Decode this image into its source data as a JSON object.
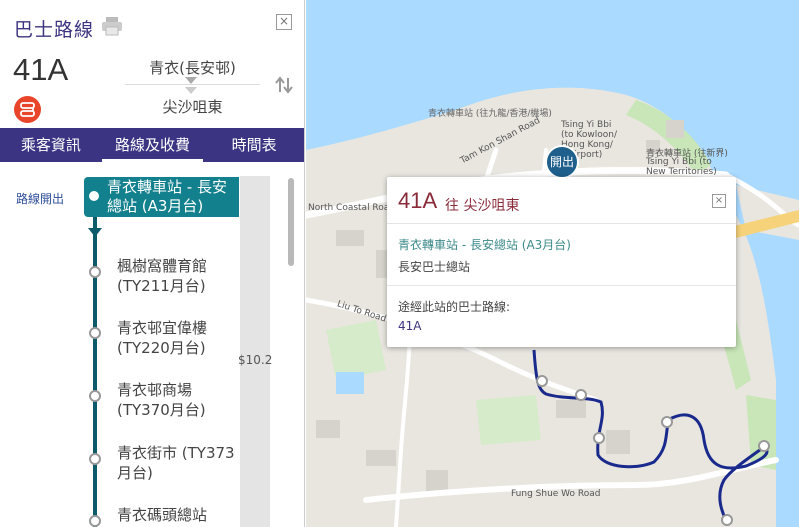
{
  "panel": {
    "title": "巴士路線",
    "route_number": "41A",
    "direction_from": "青衣(長安邨)",
    "direction_to": "尖沙咀東",
    "close_symbol": "×",
    "icons": {
      "print": "print-icon",
      "swap": "swap-direction-icon",
      "badge": "route-type-icon",
      "close": "close-icon"
    }
  },
  "tabs": [
    {
      "label": "乘客資訊"
    },
    {
      "label": "路線及收費",
      "active": true
    },
    {
      "label": "時間表"
    }
  ],
  "route_list": {
    "depart_label": "路線開出",
    "fare": "$10.2",
    "first_stop": "青衣轉車站 - 長安總站 (A3月台)",
    "stops": [
      {
        "name": "楓樹窩體育館 (TY211月台)"
      },
      {
        "name": "青衣邨宜偉樓 (TY220月台)"
      },
      {
        "name": "青衣邨商場 (TY370月台)"
      },
      {
        "name": "青衣街市 (TY373月台)"
      },
      {
        "name": "青衣碼頭總站"
      }
    ]
  },
  "map": {
    "depart_pin": "開出",
    "labels": {
      "tsing_yi_pti_kln": "青衣轉車站 (往九龍/香港/機場)",
      "tsing_yi_pti_kln_en1": "Tsing Yi Bbi",
      "tsing_yi_pti_kln_en2": "(to Kowloon/",
      "tsing_yi_pti_kln_en3": "Hong Kong/",
      "tsing_yi_pti_kln_en4": "Airport)",
      "tsing_yi_pti_nt": "青衣轉車站 (往新界)",
      "tsing_yi_pti_nt_en1": "Tsing Yi Bbi (to",
      "tsing_yi_pti_nt_en2": "New Territories)",
      "north_coastal_road": "North Coastal Road",
      "liu_to_road": "Liu To Road",
      "fung_shue_wo_road": "Fung Shue Wo Road",
      "tam_kon_shan_road": "Tam Kon Shan Road"
    },
    "colors": {
      "route": "#1a2a8c",
      "water": "#aadaff",
      "land": "#e9e6e0",
      "park": "#c8e6b8"
    }
  },
  "popup": {
    "route": "41A",
    "destination": "往 尖沙咀東",
    "close_symbol": "×",
    "stop_name": "青衣轉車站 - 長安總站 (A3月台)",
    "terminus": "長安巴士總站",
    "passing_label": "途經此站的巴士路線:",
    "passing_routes": "41A"
  }
}
